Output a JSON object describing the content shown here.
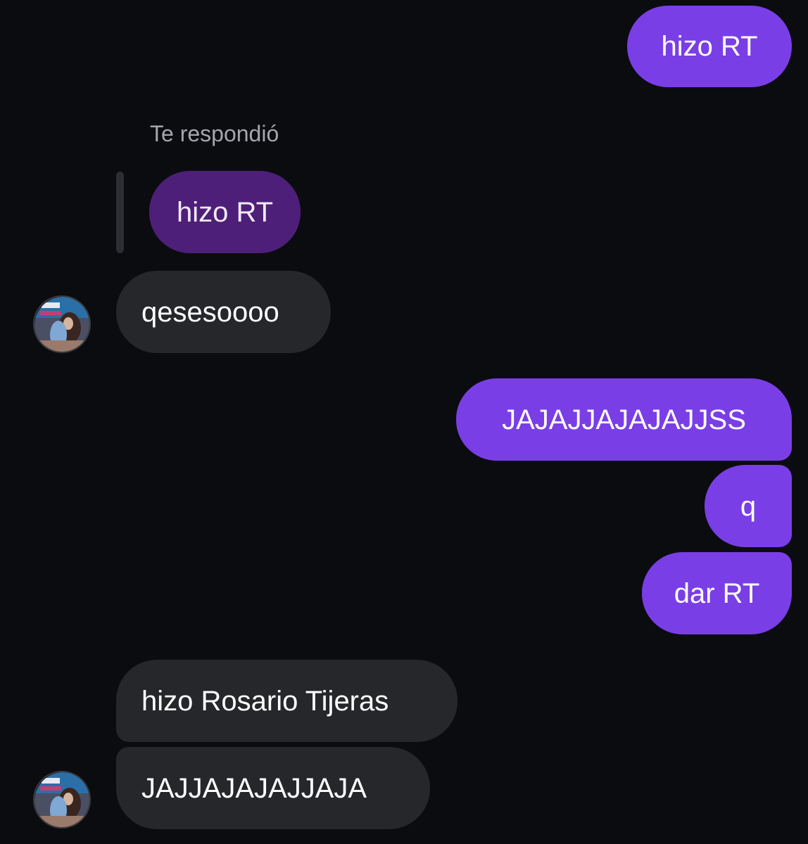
{
  "messages": {
    "m1": {
      "text": "hizo RT",
      "direction": "sent"
    },
    "reply_label": "Te respondió",
    "quoted": {
      "text": "hizo RT"
    },
    "m2": {
      "text": "qesesoooo",
      "direction": "received"
    },
    "m3": {
      "text": "JAJAJJAJAJAJJSS",
      "direction": "sent"
    },
    "m4": {
      "text": "q",
      "direction": "sent"
    },
    "m5": {
      "text": "dar RT",
      "direction": "sent"
    },
    "m6": {
      "text": "hizo Rosario Tijeras",
      "direction": "received"
    },
    "m7": {
      "text": "JAJJAJAJAJJAJA",
      "direction": "received"
    }
  },
  "colors": {
    "background": "#0b0c10",
    "sent_bubble": "#7a3ee6",
    "received_bubble": "#26272b",
    "quoted_bubble": "#4e1f78",
    "reply_label": "#a5a6ab"
  },
  "icons": {
    "contact_avatar": "contact-avatar-photo"
  }
}
